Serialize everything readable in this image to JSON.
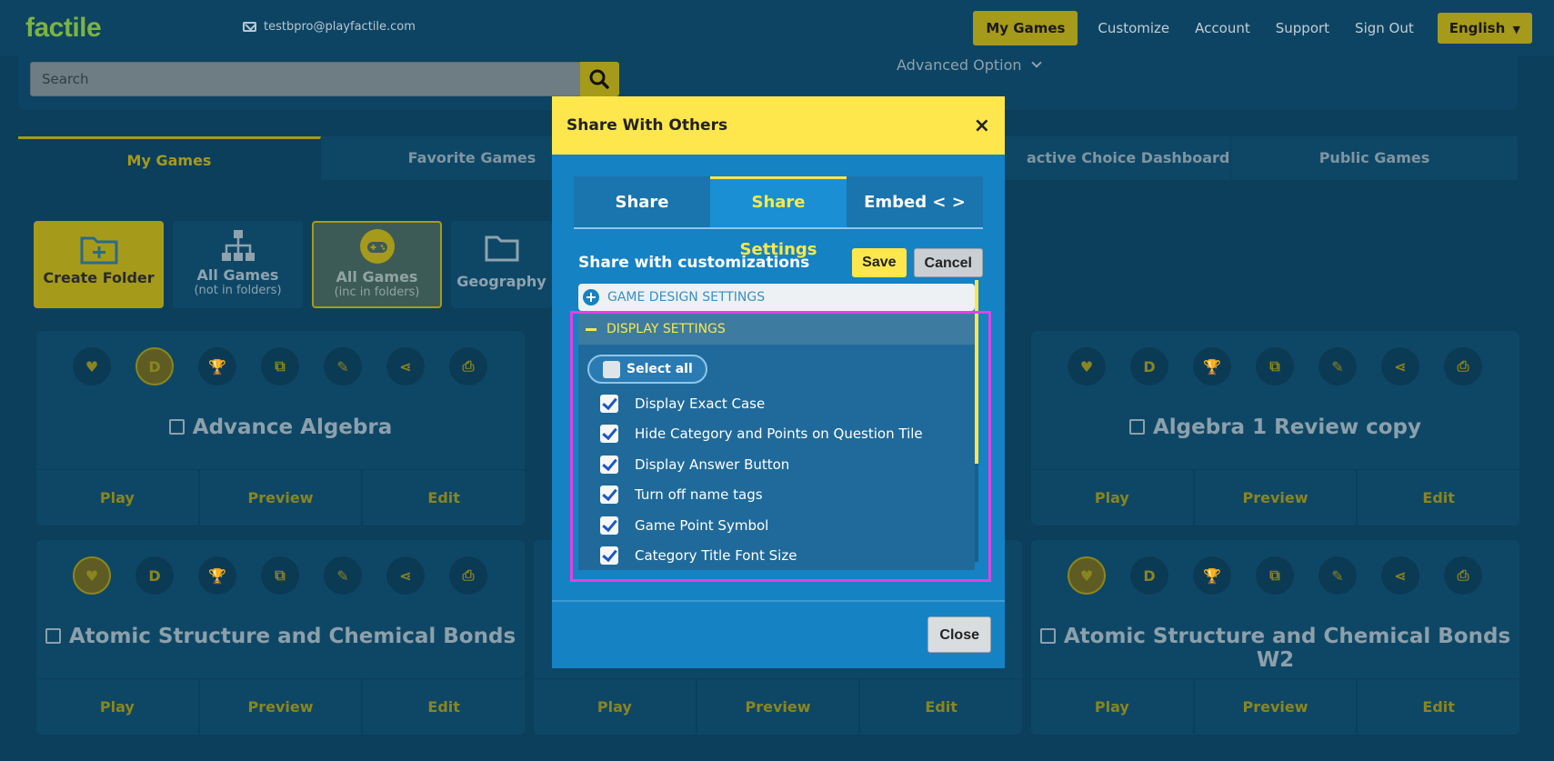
{
  "header": {
    "logo": "factile",
    "email": "testbpro@playfactile.com",
    "nav": [
      "My Games",
      "Customize",
      "Account",
      "Support",
      "Sign Out"
    ],
    "language": "English"
  },
  "search": {
    "placeholder": "Search",
    "advanced": "Advanced Option"
  },
  "tabs": [
    "My Games",
    "Favorite Games",
    "active Choice Dashboard",
    "Public Games"
  ],
  "folders": [
    {
      "title": "Create Folder",
      "sub": ""
    },
    {
      "title": "All Games",
      "sub": "(not in folders)"
    },
    {
      "title": "All Games",
      "sub": "(inc in folders)"
    },
    {
      "title": "Geography",
      "sub": ""
    }
  ],
  "cards": [
    {
      "title": "Advance Algebra"
    },
    {
      "title": "Algebra 1 Review copy"
    },
    {
      "title": "Atomic Structure and Chemical Bonds"
    },
    {
      "title": "Atomic Structure and Chemical Bonds W2"
    }
  ],
  "card_actions": [
    "Play",
    "Preview",
    "Edit"
  ],
  "card_icon_letter": "D",
  "modal": {
    "title": "Share With Others",
    "close_x": "×",
    "tabs": [
      "Share",
      "Share Settings",
      "Embed < >"
    ],
    "customizations_label": "Share with customizations",
    "save": "Save",
    "cancel": "Cancel",
    "game_design_settings": "GAME DESIGN SETTINGS",
    "display_settings": "DISPLAY SETTINGS",
    "select_all": "Select all",
    "options": [
      "Display Exact Case",
      "Hide Category and Points on Question Tile",
      "Display Answer Button",
      "Turn off name tags",
      "Game Point Symbol",
      "Category Title Font Size"
    ],
    "close": "Close"
  }
}
